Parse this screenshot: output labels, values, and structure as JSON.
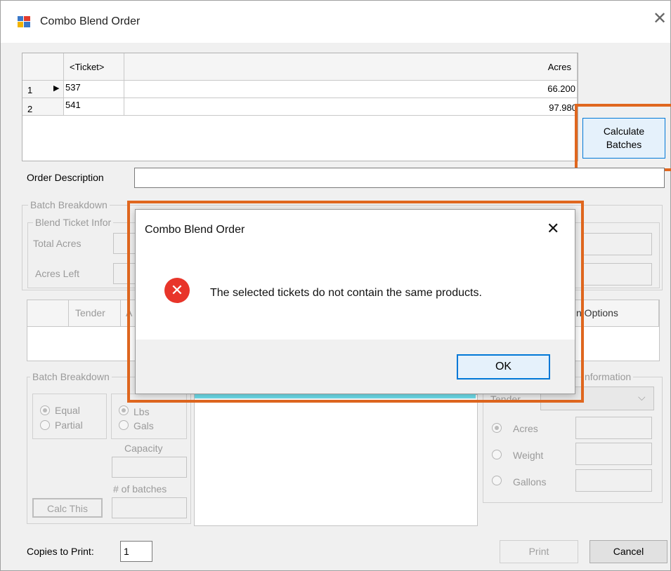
{
  "window": {
    "title": "Combo Blend Order",
    "close_glyph": "✕"
  },
  "grid": {
    "columns": [
      "<Ticket>",
      "Acres"
    ],
    "rows": [
      {
        "num": "1",
        "marker": "▶",
        "ticket": "537",
        "acres": "66.200"
      },
      {
        "num": "2",
        "marker": "",
        "ticket": "541",
        "acres": "97.980"
      }
    ]
  },
  "calc_batches": {
    "line1": "Calculate",
    "line2": "Batches"
  },
  "order_description": {
    "label": "Order Description",
    "value": ""
  },
  "batch_breakdown_section": {
    "legend": "Batch Breakdown",
    "blend_ticket_legend": "Blend Ticket Infor",
    "total_acres_label": "Total Acres",
    "acres_left_label": "Acres Left"
  },
  "tender_table": {
    "tender_header": "Tender",
    "partial_header": "A",
    "options_header": "n Options"
  },
  "batch_breakdown_lower": {
    "legend": "Batch Breakdown",
    "equal": "Equal",
    "partial": "Partial",
    "lbs": "Lbs",
    "gals": "Gals",
    "capacity_label": "Capacity",
    "batches_label": "# of batches",
    "calc_this": "Calc This"
  },
  "info_group": {
    "legend": "nformation",
    "tender_label": "Tender",
    "acres": "Acres",
    "weight": "Weight",
    "gallons": "Gallons"
  },
  "footer": {
    "copies_label": "Copies to Print:",
    "copies_value": "1",
    "print": "Print",
    "cancel": "Cancel"
  },
  "dialog": {
    "title": "Combo Blend Order",
    "close_glyph": "✕",
    "message": "The selected tickets do not contain the same products.",
    "ok": "OK",
    "icon_glyph": "✕"
  },
  "colors": {
    "highlight_orange": "#e0671f",
    "error_red": "#e8352a",
    "focus_blue": "#0078d7"
  }
}
